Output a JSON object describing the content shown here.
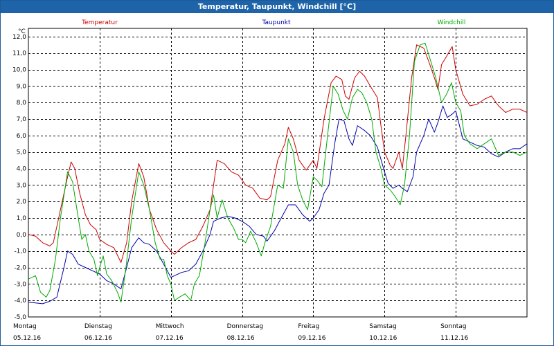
{
  "window": {
    "title": "Temperatur, Taupunkt, Windchill [°C]"
  },
  "chart_data": {
    "type": "line",
    "title": "Temperatur, Taupunkt, Windchill [°C]",
    "ylabel": "°C",
    "ylim": [
      -5.0,
      12.5
    ],
    "yticks": [
      "12,0",
      "11,0",
      "10,0",
      "9,0",
      "8,0",
      "7,0",
      "6,0",
      "5,0",
      "4,0",
      "3,0",
      "2,0",
      "1,0",
      "0,0",
      "-1,0",
      "-2,0",
      "-3,0",
      "-4,0",
      "-5,0"
    ],
    "ytick_values": [
      12,
      11,
      10,
      9,
      8,
      7,
      6,
      5,
      4,
      3,
      2,
      1,
      0,
      -1,
      -2,
      -3,
      -4,
      -5
    ],
    "xlim": [
      0,
      7
    ],
    "grid": true,
    "x_ticks": [
      {
        "day": "Montag",
        "date": "05.12.16",
        "pos": 0
      },
      {
        "day": "Dienstag",
        "date": "06.12.16",
        "pos": 1
      },
      {
        "day": "Mittwoch",
        "date": "07.12.16",
        "pos": 2
      },
      {
        "day": "Donnerstag",
        "date": "08.12.16",
        "pos": 3
      },
      {
        "day": "Freitag",
        "date": "09.12.16",
        "pos": 4
      },
      {
        "day": "Samstag",
        "date": "10.12.16",
        "pos": 5
      },
      {
        "day": "Sonntag",
        "date": "11.12.16",
        "pos": 6
      }
    ],
    "series": [
      {
        "name": "Temperatur",
        "color": "#cc0000",
        "points": [
          [
            0,
            0
          ],
          [
            0.1,
            -0.1
          ],
          [
            0.2,
            -0.5
          ],
          [
            0.3,
            -0.7
          ],
          [
            0.35,
            -0.5
          ],
          [
            0.45,
            1.5
          ],
          [
            0.55,
            3.5
          ],
          [
            0.6,
            4.4
          ],
          [
            0.65,
            4.0
          ],
          [
            0.72,
            2.5
          ],
          [
            0.8,
            1.2
          ],
          [
            0.87,
            0.6
          ],
          [
            0.95,
            0.3
          ],
          [
            1.0,
            -0.3
          ],
          [
            1.1,
            -0.6
          ],
          [
            1.2,
            -0.8
          ],
          [
            1.3,
            -1.7
          ],
          [
            1.38,
            -0.5
          ],
          [
            1.45,
            2.0
          ],
          [
            1.55,
            4.3
          ],
          [
            1.62,
            3.5
          ],
          [
            1.7,
            1.5
          ],
          [
            1.8,
            0.3
          ],
          [
            1.9,
            -0.5
          ],
          [
            2.0,
            -1.0
          ],
          [
            2.05,
            -1.2
          ],
          [
            2.15,
            -0.8
          ],
          [
            2.25,
            -0.5
          ],
          [
            2.35,
            -0.3
          ],
          [
            2.45,
            0.5
          ],
          [
            2.55,
            1.5
          ],
          [
            2.6,
            3.0
          ],
          [
            2.65,
            4.5
          ],
          [
            2.75,
            4.3
          ],
          [
            2.85,
            3.8
          ],
          [
            2.95,
            3.6
          ],
          [
            3.05,
            3.0
          ],
          [
            3.15,
            2.8
          ],
          [
            3.25,
            2.2
          ],
          [
            3.35,
            2.1
          ],
          [
            3.4,
            2.3
          ],
          [
            3.5,
            4.5
          ],
          [
            3.6,
            5.5
          ],
          [
            3.65,
            6.5
          ],
          [
            3.72,
            5.8
          ],
          [
            3.8,
            4.5
          ],
          [
            3.9,
            3.9
          ],
          [
            4.0,
            4.5
          ],
          [
            4.05,
            4.0
          ],
          [
            4.15,
            7.0
          ],
          [
            4.25,
            9.2
          ],
          [
            4.32,
            9.6
          ],
          [
            4.4,
            9.4
          ],
          [
            4.45,
            8.4
          ],
          [
            4.5,
            8.2
          ],
          [
            4.58,
            9.5
          ],
          [
            4.65,
            9.9
          ],
          [
            4.72,
            9.6
          ],
          [
            4.8,
            9.0
          ],
          [
            4.9,
            8.3
          ],
          [
            4.95,
            6.6
          ],
          [
            5.0,
            5.0
          ],
          [
            5.08,
            4.2
          ],
          [
            5.12,
            4.0
          ],
          [
            5.2,
            5.0
          ],
          [
            5.25,
            4.0
          ],
          [
            5.3,
            6.0
          ],
          [
            5.38,
            9.5
          ],
          [
            5.45,
            11.5
          ],
          [
            5.55,
            11.3
          ],
          [
            5.62,
            10.5
          ],
          [
            5.7,
            9.5
          ],
          [
            5.75,
            8.8
          ],
          [
            5.8,
            10.3
          ],
          [
            5.87,
            10.8
          ],
          [
            5.95,
            11.4
          ],
          [
            6.0,
            10.0
          ],
          [
            6.1,
            8.5
          ],
          [
            6.2,
            7.8
          ],
          [
            6.3,
            7.9
          ],
          [
            6.4,
            8.2
          ],
          [
            6.5,
            8.4
          ],
          [
            6.6,
            7.8
          ],
          [
            6.7,
            7.4
          ],
          [
            6.8,
            7.6
          ],
          [
            6.9,
            7.6
          ],
          [
            7.0,
            7.4
          ]
        ]
      },
      {
        "name": "Taupunkt",
        "color": "#0000aa",
        "points": [
          [
            0,
            -4.1
          ],
          [
            0.1,
            -4.15
          ],
          [
            0.2,
            -4.2
          ],
          [
            0.3,
            -4.05
          ],
          [
            0.4,
            -3.8
          ],
          [
            0.5,
            -2.0
          ],
          [
            0.55,
            -1.0
          ],
          [
            0.62,
            -1.2
          ],
          [
            0.7,
            -1.8
          ],
          [
            0.8,
            -2.0
          ],
          [
            0.9,
            -2.2
          ],
          [
            1.0,
            -2.4
          ],
          [
            1.1,
            -2.8
          ],
          [
            1.2,
            -3.0
          ],
          [
            1.3,
            -3.3
          ],
          [
            1.38,
            -2.0
          ],
          [
            1.45,
            -0.8
          ],
          [
            1.55,
            -0.2
          ],
          [
            1.62,
            -0.5
          ],
          [
            1.7,
            -0.6
          ],
          [
            1.8,
            -1.0
          ],
          [
            1.9,
            -1.8
          ],
          [
            2.0,
            -2.6
          ],
          [
            2.05,
            -2.5
          ],
          [
            2.15,
            -2.3
          ],
          [
            2.25,
            -2.2
          ],
          [
            2.35,
            -1.8
          ],
          [
            2.45,
            -1.0
          ],
          [
            2.55,
            0.0
          ],
          [
            2.6,
            0.8
          ],
          [
            2.7,
            1.0
          ],
          [
            2.8,
            1.1
          ],
          [
            2.9,
            1.0
          ],
          [
            3.0,
            0.8
          ],
          [
            3.1,
            0.5
          ],
          [
            3.2,
            0.0
          ],
          [
            3.3,
            -0.1
          ],
          [
            3.35,
            -0.4
          ],
          [
            3.45,
            0.2
          ],
          [
            3.55,
            1.0
          ],
          [
            3.65,
            1.8
          ],
          [
            3.75,
            1.8
          ],
          [
            3.85,
            1.2
          ],
          [
            3.95,
            0.8
          ],
          [
            4.0,
            1.0
          ],
          [
            4.08,
            1.5
          ],
          [
            4.15,
            2.5
          ],
          [
            4.22,
            3.0
          ],
          [
            4.3,
            5.5
          ],
          [
            4.36,
            7.0
          ],
          [
            4.43,
            6.9
          ],
          [
            4.5,
            5.8
          ],
          [
            4.55,
            5.4
          ],
          [
            4.62,
            6.6
          ],
          [
            4.72,
            6.3
          ],
          [
            4.8,
            6.0
          ],
          [
            4.9,
            5.3
          ],
          [
            5.0,
            3.8
          ],
          [
            5.05,
            3.1
          ],
          [
            5.12,
            2.8
          ],
          [
            5.2,
            3.0
          ],
          [
            5.25,
            2.8
          ],
          [
            5.32,
            2.6
          ],
          [
            5.4,
            3.5
          ],
          [
            5.45,
            5.0
          ],
          [
            5.55,
            6.0
          ],
          [
            5.62,
            7.0
          ],
          [
            5.7,
            6.2
          ],
          [
            5.75,
            6.8
          ],
          [
            5.82,
            7.8
          ],
          [
            5.88,
            7.1
          ],
          [
            5.95,
            7.3
          ],
          [
            6.0,
            7.5
          ],
          [
            6.1,
            5.8
          ],
          [
            6.2,
            5.6
          ],
          [
            6.3,
            5.4
          ],
          [
            6.4,
            5.3
          ],
          [
            6.5,
            4.9
          ],
          [
            6.6,
            4.7
          ],
          [
            6.7,
            5.0
          ],
          [
            6.8,
            5.2
          ],
          [
            6.9,
            5.2
          ],
          [
            7.0,
            5.5
          ]
        ]
      },
      {
        "name": "Windchill",
        "color": "#00aa00",
        "points": [
          [
            0,
            -2.7
          ],
          [
            0.1,
            -2.5
          ],
          [
            0.17,
            -3.5
          ],
          [
            0.25,
            -3.8
          ],
          [
            0.3,
            -3.4
          ],
          [
            0.38,
            -1.5
          ],
          [
            0.45,
            1.0
          ],
          [
            0.55,
            3.8
          ],
          [
            0.62,
            3.2
          ],
          [
            0.7,
            1.0
          ],
          [
            0.75,
            -0.3
          ],
          [
            0.8,
            0.0
          ],
          [
            0.85,
            -1.0
          ],
          [
            0.92,
            -1.5
          ],
          [
            0.97,
            -2.5
          ],
          [
            1.0,
            -2.0
          ],
          [
            1.05,
            -1.3
          ],
          [
            1.1,
            -2.4
          ],
          [
            1.17,
            -2.8
          ],
          [
            1.25,
            -3.5
          ],
          [
            1.3,
            -4.1
          ],
          [
            1.37,
            -2.0
          ],
          [
            1.45,
            1.0
          ],
          [
            1.55,
            3.8
          ],
          [
            1.62,
            3.0
          ],
          [
            1.7,
            1.5
          ],
          [
            1.78,
            -0.5
          ],
          [
            1.85,
            -1.5
          ],
          [
            1.9,
            -1.5
          ],
          [
            1.95,
            -2.5
          ],
          [
            2.0,
            -3.0
          ],
          [
            2.05,
            -4.0
          ],
          [
            2.12,
            -3.8
          ],
          [
            2.2,
            -3.6
          ],
          [
            2.28,
            -4.0
          ],
          [
            2.33,
            -3.0
          ],
          [
            2.4,
            -2.5
          ],
          [
            2.48,
            -0.5
          ],
          [
            2.55,
            1.5
          ],
          [
            2.6,
            2.4
          ],
          [
            2.65,
            1.0
          ],
          [
            2.72,
            2.1
          ],
          [
            2.8,
            1.0
          ],
          [
            2.88,
            0.4
          ],
          [
            2.95,
            -0.3
          ],
          [
            3.0,
            -0.3
          ],
          [
            3.05,
            -0.5
          ],
          [
            3.12,
            0.2
          ],
          [
            3.2,
            -0.5
          ],
          [
            3.27,
            -1.3
          ],
          [
            3.32,
            -0.5
          ],
          [
            3.4,
            0.5
          ],
          [
            3.5,
            3.0
          ],
          [
            3.58,
            2.8
          ],
          [
            3.65,
            5.8
          ],
          [
            3.72,
            5.0
          ],
          [
            3.78,
            3.0
          ],
          [
            3.85,
            2.1
          ],
          [
            3.92,
            1.5
          ],
          [
            4.0,
            3.5
          ],
          [
            4.05,
            3.3
          ],
          [
            4.12,
            2.9
          ],
          [
            4.2,
            6.0
          ],
          [
            4.28,
            9.0
          ],
          [
            4.35,
            8.5
          ],
          [
            4.42,
            7.5
          ],
          [
            4.48,
            7.0
          ],
          [
            4.55,
            8.3
          ],
          [
            4.62,
            8.8
          ],
          [
            4.68,
            8.6
          ],
          [
            4.75,
            8.0
          ],
          [
            4.82,
            7.0
          ],
          [
            4.88,
            5.0
          ],
          [
            4.95,
            4.0
          ],
          [
            5.0,
            3.0
          ],
          [
            5.08,
            2.7
          ],
          [
            5.15,
            2.3
          ],
          [
            5.22,
            1.8
          ],
          [
            5.28,
            3.0
          ],
          [
            5.35,
            6.0
          ],
          [
            5.42,
            10.5
          ],
          [
            5.5,
            11.5
          ],
          [
            5.57,
            11.6
          ],
          [
            5.65,
            10.5
          ],
          [
            5.72,
            9.5
          ],
          [
            5.8,
            8.0
          ],
          [
            5.87,
            8.5
          ],
          [
            5.94,
            9.2
          ],
          [
            6.0,
            8.0
          ],
          [
            6.07,
            7.5
          ],
          [
            6.12,
            6.0
          ],
          [
            6.2,
            5.5
          ],
          [
            6.3,
            5.2
          ],
          [
            6.4,
            5.5
          ],
          [
            6.5,
            5.8
          ],
          [
            6.6,
            4.8
          ],
          [
            6.7,
            5.0
          ],
          [
            6.8,
            5.0
          ],
          [
            6.9,
            4.8
          ],
          [
            7.0,
            5.0
          ]
        ]
      }
    ]
  }
}
